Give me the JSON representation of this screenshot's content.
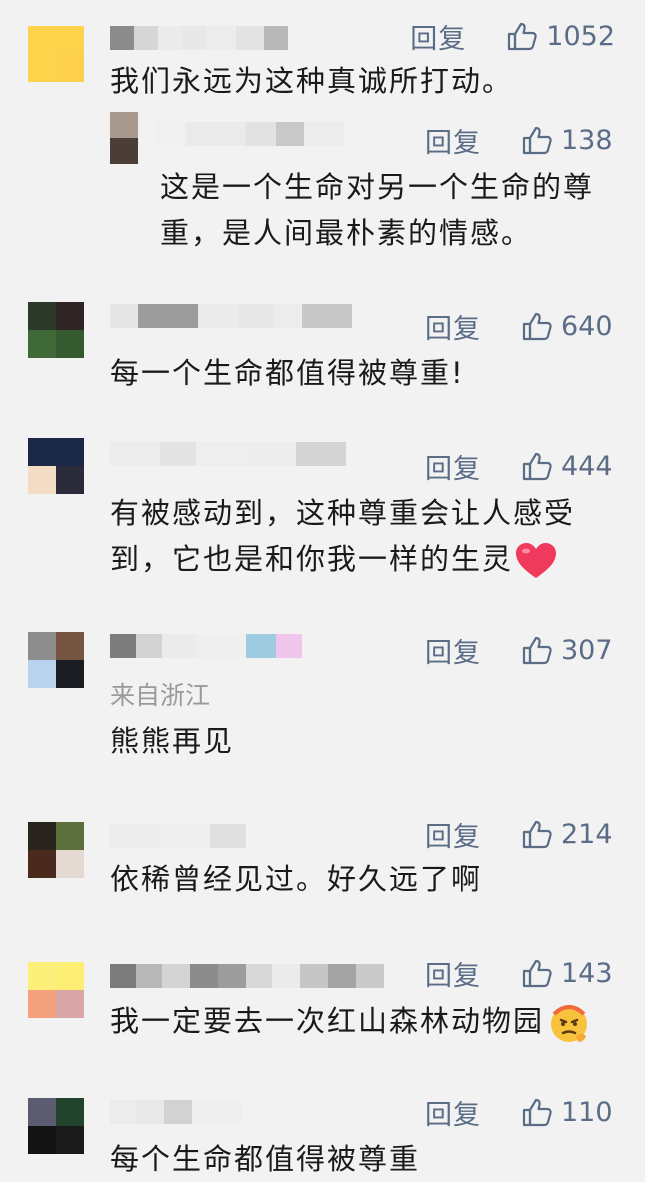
{
  "reply_label": "回复",
  "comments": [
    {
      "text": "我们永远为这种真诚所打动。",
      "likes": "1052"
    },
    {
      "text": "这是一个生命对另一个生命的尊重，是人间最朴素的情感。",
      "likes": "138"
    },
    {
      "text": "每一个生命都值得被尊重!",
      "likes": "640"
    },
    {
      "text": "有被感动到，这种尊重会让人感受到，它也是和你我一样的生灵",
      "likes": "444"
    },
    {
      "text": "熊熊再见",
      "likes": "307",
      "location": "来自浙江"
    },
    {
      "text": "依稀曾经见过。好久远了啊",
      "likes": "214"
    },
    {
      "text": "我一定要去一次红山森林动物园",
      "likes": "143"
    },
    {
      "text": "每个生命都值得被尊重",
      "likes": "110"
    }
  ],
  "colors": {
    "accent": "#5b6c87",
    "heart": "#ef3a5d"
  },
  "icons": {
    "like": "thumbs-up-icon",
    "heart": "red-heart-emoji",
    "face": "thinking-face-emoji"
  }
}
